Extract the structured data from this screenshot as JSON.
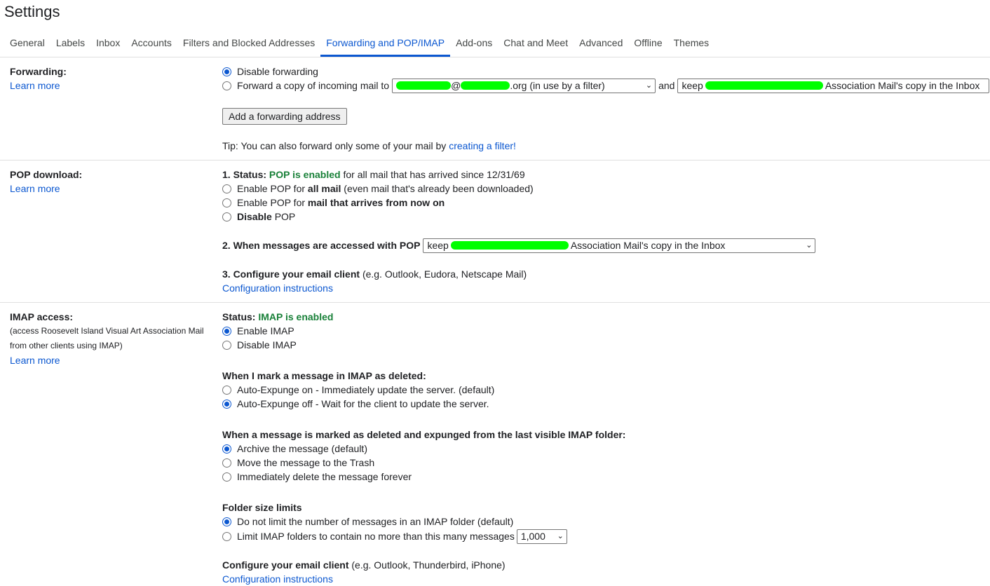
{
  "page": {
    "title": "Settings"
  },
  "tabs": [
    {
      "label": "General"
    },
    {
      "label": "Labels"
    },
    {
      "label": "Inbox"
    },
    {
      "label": "Accounts"
    },
    {
      "label": "Filters and Blocked Addresses"
    },
    {
      "label": "Forwarding and POP/IMAP",
      "active": true
    },
    {
      "label": "Add-ons"
    },
    {
      "label": "Chat and Meet"
    },
    {
      "label": "Advanced"
    },
    {
      "label": "Offline"
    },
    {
      "label": "Themes"
    }
  ],
  "common": {
    "learn_more": "Learn more"
  },
  "forwarding": {
    "label": "Forwarding:",
    "disable": "Disable forwarding",
    "forward_prefix": "Forward a copy of incoming mail to",
    "address_at": "@",
    "address_suffix": ".org (in use by a filter)",
    "and": "and",
    "action_prefix": "keep",
    "action_suffix": "Association Mail's copy in the Inbox",
    "add_button": "Add a forwarding address",
    "tip_prefix": "Tip: You can also forward only some of your mail by",
    "tip_link": "creating a filter!"
  },
  "pop": {
    "label": "POP download:",
    "status_prefix": "1. Status:",
    "status_value": "POP is enabled",
    "status_suffix": "for all mail that has arrived since 12/31/69",
    "opt1_prefix": "Enable POP for",
    "opt1_bold": "all mail",
    "opt1_suffix": "(even mail that's already been downloaded)",
    "opt2_prefix": "Enable POP for",
    "opt2_bold": "mail that arrives from now on",
    "opt3_bold": "Disable",
    "opt3_suffix": "POP",
    "access_label": "2. When messages are accessed with POP",
    "access_prefix": "keep",
    "access_suffix": "Association Mail's copy in the Inbox",
    "config_bold": "3. Configure your email client",
    "config_suffix": "(e.g. Outlook, Eudora, Netscape Mail)",
    "config_link": "Configuration instructions"
  },
  "imap": {
    "label": "IMAP access:",
    "desc_line1": "(access Roosevelt Island Visual Art Association Mail",
    "desc_line2": "from other clients using IMAP)",
    "status_prefix": "Status:",
    "status_value": "IMAP is enabled",
    "enable": "Enable IMAP",
    "disable": "Disable IMAP",
    "deleted_heading": "When I mark a message in IMAP as deleted:",
    "expunge_on": "Auto-Expunge on - Immediately update the server. (default)",
    "expunge_off": "Auto-Expunge off - Wait for the client to update the server.",
    "expunged_heading": "When a message is marked as deleted and expunged from the last visible IMAP folder:",
    "archive": "Archive the message (default)",
    "trash": "Move the message to the Trash",
    "delete_forever": "Immediately delete the message forever",
    "folder_heading": "Folder size limits",
    "no_limit": "Do not limit the number of messages in an IMAP folder (default)",
    "limit": "Limit IMAP folders to contain no more than this many messages",
    "limit_value": "1,000",
    "config_bold": "Configure your email client",
    "config_suffix": "(e.g. Outlook, Thunderbird, iPhone)",
    "config_link": "Configuration instructions"
  },
  "colors": {
    "accent": "#0b57d0",
    "enabled_green": "#188038",
    "redaction": "#00ff00"
  }
}
